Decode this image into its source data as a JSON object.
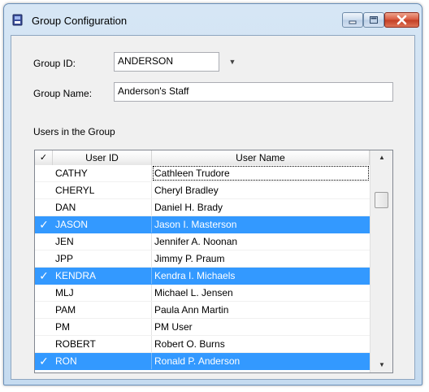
{
  "window": {
    "title": "Group Configuration",
    "icon": "app-icon"
  },
  "form": {
    "group_id_label": "Group ID:",
    "group_id_value": "ANDERSON",
    "group_name_label": "Group Name:",
    "group_name_value": "Anderson's Staff",
    "users_section_label": "Users in the Group"
  },
  "grid": {
    "columns": {
      "check": "✓",
      "user_id": "User ID",
      "user_name": "User Name"
    },
    "rows": [
      {
        "id": "CATHY",
        "name": "Cathleen Trudore",
        "checked": false,
        "focused": true
      },
      {
        "id": "CHERYL",
        "name": "Cheryl Bradley",
        "checked": false
      },
      {
        "id": "DAN",
        "name": "Daniel H. Brady",
        "checked": false
      },
      {
        "id": "JASON",
        "name": "Jason I. Masterson",
        "checked": true
      },
      {
        "id": "JEN",
        "name": "Jennifer A. Noonan",
        "checked": false
      },
      {
        "id": "JPP",
        "name": "Jimmy P. Praum",
        "checked": false
      },
      {
        "id": "KENDRA",
        "name": "Kendra I. Michaels",
        "checked": true
      },
      {
        "id": "MLJ",
        "name": "Michael L. Jensen",
        "checked": false
      },
      {
        "id": "PAM",
        "name": "Paula Ann Martin",
        "checked": false
      },
      {
        "id": "PM",
        "name": "PM User",
        "checked": false
      },
      {
        "id": "ROBERT",
        "name": "Robert O. Burns",
        "checked": false
      },
      {
        "id": "RON",
        "name": "Ronald P. Anderson",
        "checked": true
      }
    ],
    "check_glyph": "✓"
  },
  "colors": {
    "selection": "#3399ff",
    "title_bar": "#c5dbf0",
    "close_button": "#c23d23"
  }
}
